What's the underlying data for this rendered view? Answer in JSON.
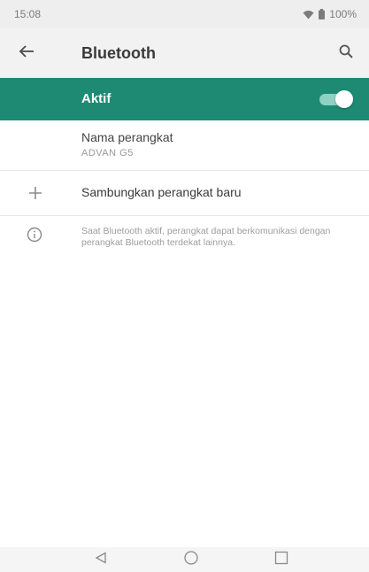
{
  "status_bar": {
    "time": "15:08",
    "battery": "100%"
  },
  "app_bar": {
    "title": "Bluetooth",
    "back_icon": "arrow-left-icon",
    "search_icon": "search-icon"
  },
  "bluetooth_toggle": {
    "label": "Aktif",
    "state": "on",
    "accent_color": "#1f8a73"
  },
  "device_name": {
    "title": "Nama perangkat",
    "value": "ADVAN G5"
  },
  "pair_new_device": {
    "label": "Sambungkan perangkat baru",
    "icon": "plus-icon"
  },
  "info": {
    "text": "Saat Bluetooth aktif, perangkat dapat berkomunikasi dengan perangkat Bluetooth terdekat lainnya.",
    "icon": "info-icon"
  },
  "nav_bar": {
    "back_icon": "triangle-back-icon",
    "home_icon": "circle-home-icon",
    "recents_icon": "square-recents-icon"
  }
}
